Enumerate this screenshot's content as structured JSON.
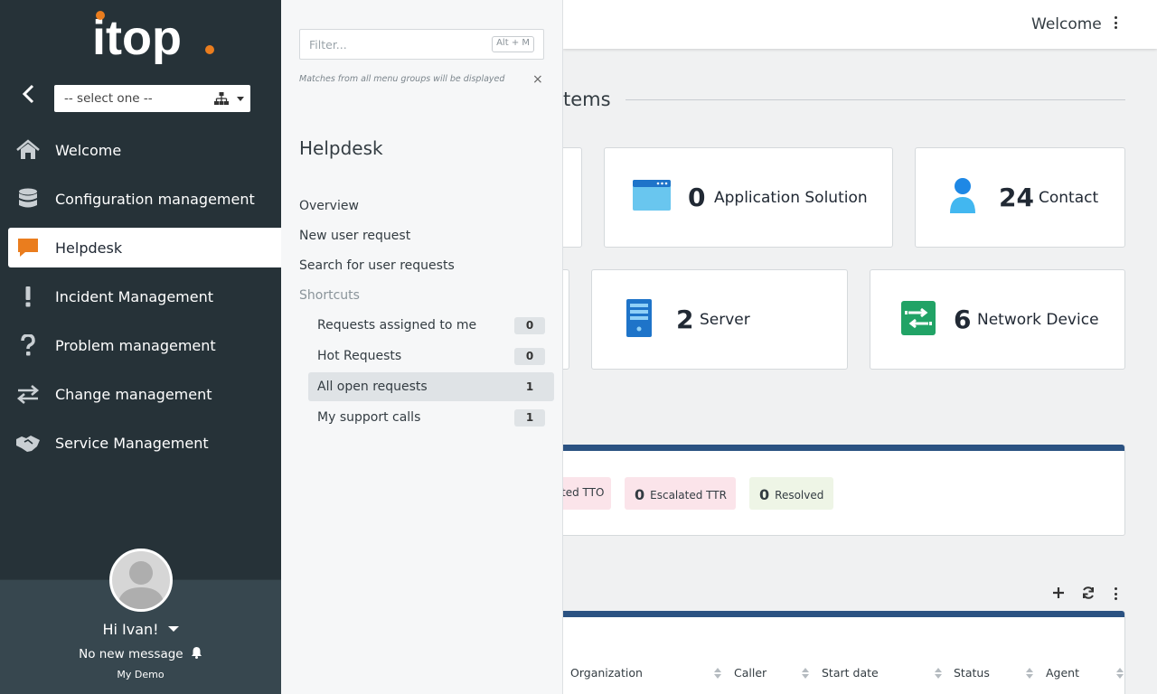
{
  "app": {
    "logo_text": "itop",
    "brand_color": "#ea7d1e"
  },
  "org_selector": {
    "value": "-- select one --"
  },
  "nav": {
    "items": [
      {
        "label": "Welcome",
        "icon": "home-icon"
      },
      {
        "label": "Configuration management",
        "icon": "database-icon"
      },
      {
        "label": "Helpdesk",
        "icon": "chat-bubble-icon",
        "active": true
      },
      {
        "label": "Incident Management",
        "icon": "exclamation-icon"
      },
      {
        "label": "Problem management",
        "icon": "question-icon"
      },
      {
        "label": "Change management",
        "icon": "exchange-arrows-icon"
      },
      {
        "label": "Service Management",
        "icon": "handshake-icon"
      }
    ]
  },
  "user": {
    "greeting": "Hi Ivan!",
    "messages": "No new message",
    "organization": "My Demo"
  },
  "flyout": {
    "filter_placeholder": "Filter...",
    "filter_shortcut": "Alt + M",
    "filter_hint": "Matches from all menu groups will be displayed",
    "title": "Helpdesk",
    "links": [
      "Overview",
      "New user request",
      "Search for user requests"
    ],
    "shortcuts_label": "Shortcuts",
    "shortcuts": [
      {
        "label": "Requests assigned to me",
        "count": "0"
      },
      {
        "label": "Hot Requests",
        "count": "0"
      },
      {
        "label": "All open requests",
        "count": "1",
        "active": true
      },
      {
        "label": "My support calls",
        "count": "1"
      }
    ]
  },
  "header": {
    "welcome": "Welcome"
  },
  "main": {
    "section_title": "tems",
    "tiles": [
      {
        "count": "0",
        "label": "Application Solution",
        "icon": "application-window-icon"
      },
      {
        "count": "24",
        "label": "Contact",
        "icon": "person-icon"
      },
      {
        "count": "2",
        "label": "Server",
        "icon": "server-icon"
      },
      {
        "count": "6",
        "label": "Network Device",
        "icon": "network-switch-icon"
      }
    ],
    "status_pills": [
      {
        "count": "",
        "label": "ted TTO",
        "color": "#fbe4ea"
      },
      {
        "count": "0",
        "label": "Escalated TTR",
        "color": "#fbe4ea"
      },
      {
        "count": "0",
        "label": "Resolved",
        "color": "#eef5e6"
      }
    ],
    "table_columns": [
      "Organization",
      "Caller",
      "Start date",
      "Status",
      "Agent"
    ]
  },
  "colors": {
    "nav_bg": "#263238",
    "user_panel_bg": "#37474f",
    "panel_accent": "#2b5282"
  }
}
